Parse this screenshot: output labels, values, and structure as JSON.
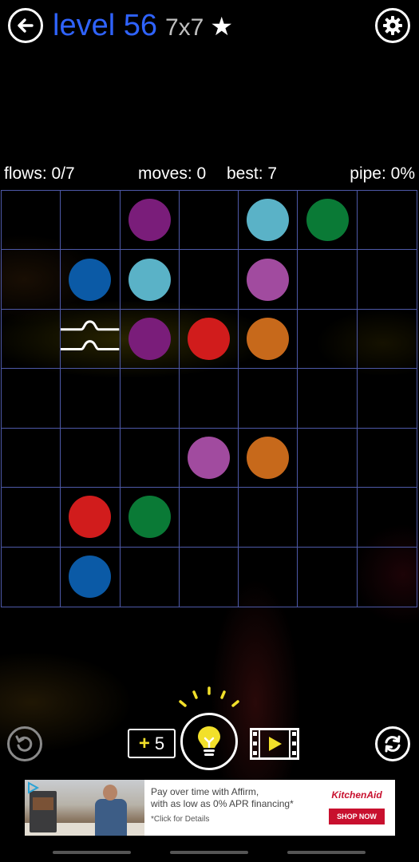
{
  "header": {
    "level_title": "level 56",
    "grid_size": "7x7",
    "star": "★",
    "back_icon": "arrow-left-icon",
    "settings_icon": "gear-icon"
  },
  "stats": {
    "flows": "flows: 0/7",
    "moves": "moves: 0",
    "best": "best: 7",
    "pipe": "pipe: 0%"
  },
  "colors": {
    "purple": "#7a1d7a",
    "cyan": "#5ab2c7",
    "green": "#0a7a36",
    "blue": "#0b5aa6",
    "pink": "#a14b9f",
    "red": "#d11c1c",
    "orange": "#c7691b",
    "title_blue": "#2f63ff",
    "grid_line": "#4e59a8",
    "hint_yellow": "#f2e02a"
  },
  "board": {
    "rows": 7,
    "cols": 7,
    "cells": [
      [
        "",
        "",
        "purple",
        "",
        "cyan",
        "green",
        ""
      ],
      [
        "",
        "blue",
        "cyan",
        "",
        "pink",
        "",
        ""
      ],
      [
        "",
        "bridge",
        "purple",
        "red",
        "orange",
        "",
        ""
      ],
      [
        "",
        "",
        "",
        "",
        "",
        "",
        ""
      ],
      [
        "",
        "",
        "",
        "pink",
        "orange",
        "",
        ""
      ],
      [
        "",
        "red",
        "green",
        "",
        "",
        "",
        ""
      ],
      [
        "",
        "blue",
        "",
        "",
        "",
        "",
        ""
      ]
    ]
  },
  "controls": {
    "plus_sign": "+",
    "hint_count": "5",
    "undo_icon": "undo-icon",
    "hint_icon": "lightbulb-icon",
    "video_icon": "video-play-icon",
    "restart_icon": "restart-icon"
  },
  "ad": {
    "line1": "Pay over time with Affirm,",
    "line2": "with as low as 0% APR financing*",
    "line3": "*Click for Details",
    "brand": "KitchenAid",
    "cta": "SHOP NOW"
  }
}
